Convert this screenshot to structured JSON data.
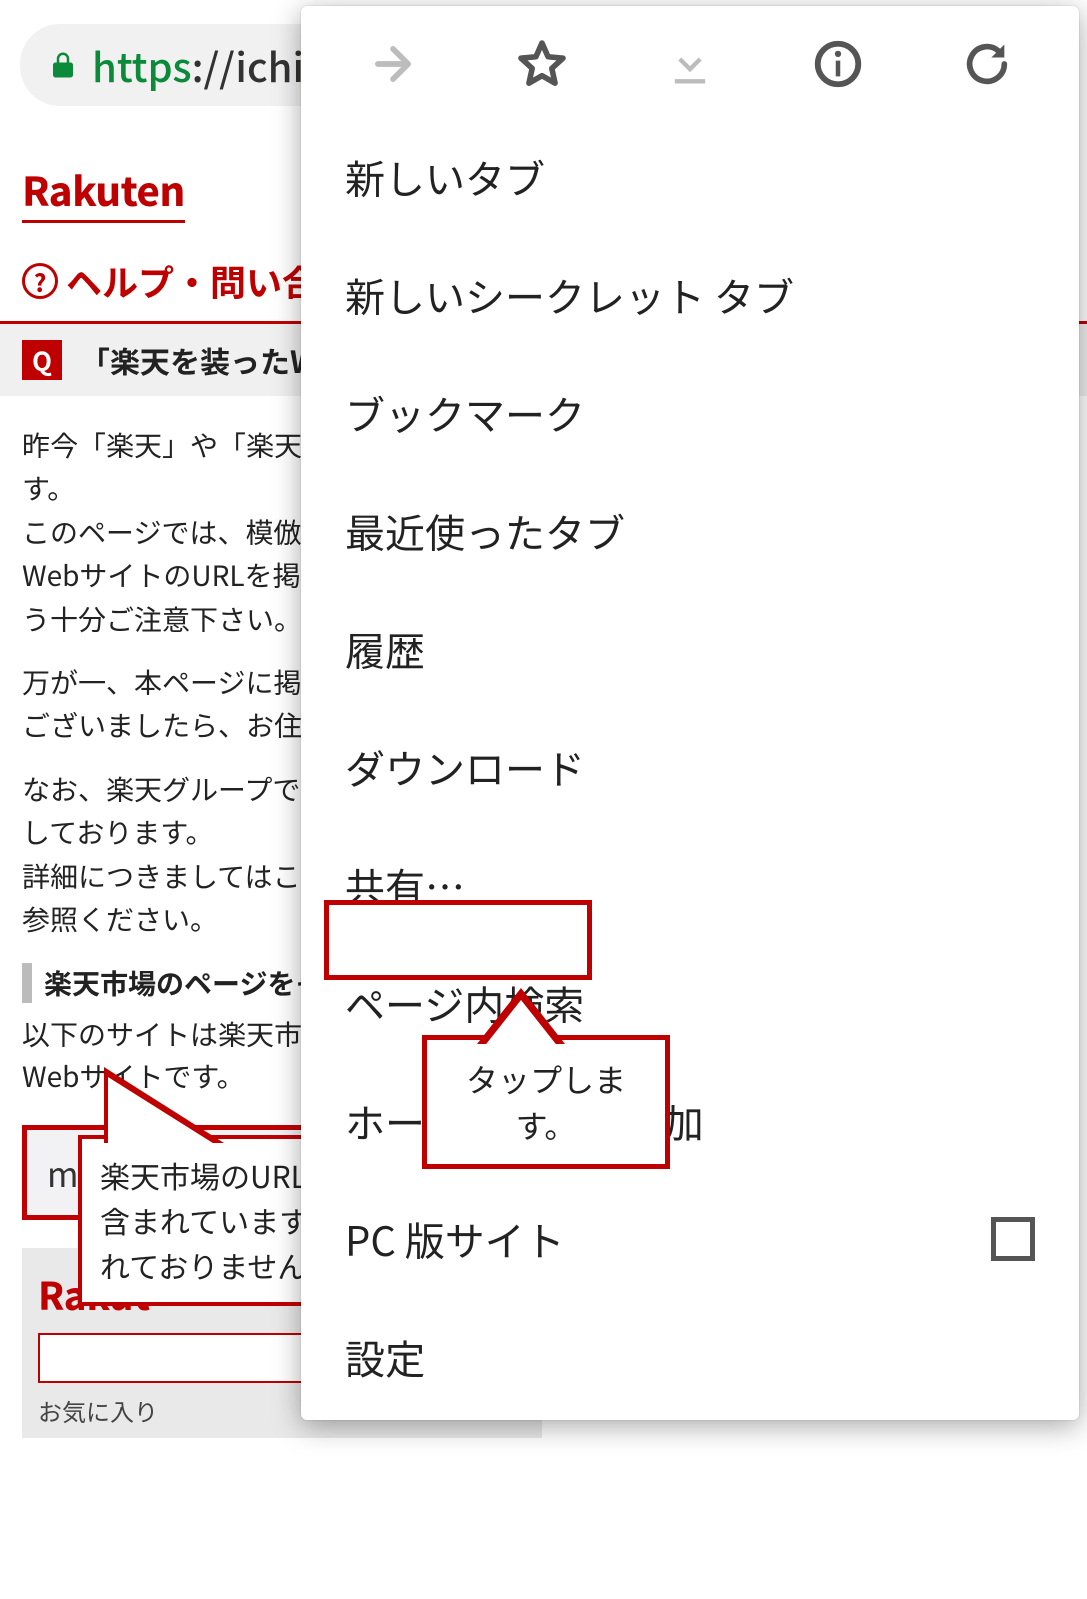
{
  "url": {
    "scheme": "https",
    "rest": "://ichib"
  },
  "page": {
    "brand": "Rakuten",
    "help": "ヘルプ・問い合わせ",
    "q_label": "Q",
    "q_title": "「楽天を装ったWEBサ",
    "p1": "昨今「楽天」や「楽天市場の\nす。\nこのページでは、模倣サイト\nWebサイトのURLを掲載し\nう十分ご注意下さい。",
    "p2": "万が一、本ページに掲載され\nございましたら、お住まいの",
    "p3": "なお、楽天グループでは個人\nしております。\n詳細につきましてはこちらの\n参照ください。",
    "sect": "楽天市場のページをそっく",
    "sub": "以下のサイトは楽天市場の。\nWebサイトです。",
    "fake_url": "mili.donyttellany",
    "fake_logo": "Rakut",
    "fake_fav": "お気に入り",
    "callout_url": "楽天市場のURL\n含まれています\nれておりません"
  },
  "menu": {
    "items": [
      "新しいタブ",
      "新しいシークレット タブ",
      "ブックマーク",
      "最近使ったタブ",
      "履歴",
      "ダウンロード",
      "共有…",
      "ページ内検索",
      "ホーム　　　　追加",
      "PC 版サイト",
      "設定"
    ]
  },
  "callout_tap": "タップします。"
}
